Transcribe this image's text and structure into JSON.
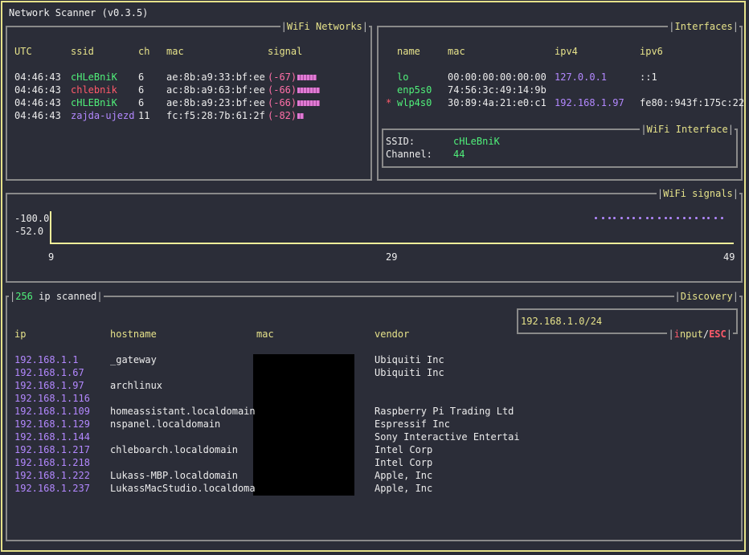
{
  "app": {
    "title": "Network Scanner (v0.3.5)"
  },
  "wifi_networks": {
    "title": "WiFi Networks",
    "columns": [
      "UTC",
      "ssid",
      "ch",
      "mac",
      "signal"
    ],
    "rows": [
      {
        "utc": "04:46:43",
        "ssid": "cHLeBniK",
        "ch": "6",
        "mac": "ae:8b:a9:33:bf:ee",
        "signal": "(-67)",
        "strength": 0.6,
        "color": "#50f07a"
      },
      {
        "utc": "04:46:43",
        "ssid": "chlebnik",
        "ch": "6",
        "mac": "ac:8b:a9:63:bf:ee",
        "signal": "(-66)",
        "strength": 0.7,
        "color": "#ff5a6a"
      },
      {
        "utc": "04:46:43",
        "ssid": "cHLEBniK",
        "ch": "6",
        "mac": "ae:8b:a9:23:bf:ee",
        "signal": "(-66)",
        "strength": 0.7,
        "color": "#50f07a"
      },
      {
        "utc": "04:46:43",
        "ssid": "zajda-ujezd",
        "ch": "11",
        "mac": "fc:f5:28:7b:61:2f",
        "signal": "(-82)",
        "strength": 0.2,
        "color": "#b388ff"
      }
    ]
  },
  "interfaces": {
    "title": "Interfaces",
    "columns": [
      "name",
      "mac",
      "ipv4",
      "ipv6"
    ],
    "rows": [
      {
        "marker": "",
        "name": "lo",
        "mac": "00:00:00:00:00:00",
        "ipv4": "127.0.0.1",
        "ipv6": "::1"
      },
      {
        "marker": "",
        "name": "enp5s0",
        "mac": "74:56:3c:49:14:9b",
        "ipv4": "",
        "ipv6": ""
      },
      {
        "marker": "*",
        "name": "wlp4s0",
        "mac": "30:89:4a:21:e0:c1",
        "ipv4": "192.168.1.97",
        "ipv6": "fe80::943f:175c:22"
      }
    ]
  },
  "wifi_interface": {
    "title": "WiFi Interface",
    "ssid_label": "SSID:",
    "ssid_value": "cHLeBniK",
    "channel_label": "Channel:",
    "channel_value": "44"
  },
  "wifi_signals": {
    "title": "WiFi signals",
    "y_top": "-100.0",
    "y_bottom": "-52.0",
    "x_start": "9",
    "x_mid": "29",
    "x_end": "49"
  },
  "chart_data": {
    "type": "scatter",
    "title": "WiFi signals",
    "xlim": [
      9,
      49
    ],
    "ylim": [
      -100.0,
      -52.0
    ],
    "x_ticks": [
      "9",
      "29",
      "49"
    ],
    "y_ticks": [
      "-100.0",
      "-52.0"
    ],
    "series": [
      {
        "values": [
          [
            40.9,
            -100
          ],
          [
            41.3,
            -100
          ],
          [
            41.7,
            -100
          ],
          [
            42.0,
            -100
          ],
          [
            42.4,
            -100
          ],
          [
            42.8,
            -100
          ],
          [
            43.1,
            -100
          ],
          [
            43.5,
            -100
          ],
          [
            43.9,
            -100
          ],
          [
            44.2,
            -100
          ],
          [
            44.6,
            -100
          ],
          [
            45.0,
            -100
          ],
          [
            45.3,
            -100
          ],
          [
            45.7,
            -100
          ],
          [
            46.1,
            -100
          ],
          [
            46.4,
            -100
          ],
          [
            46.8,
            -100
          ],
          [
            47.2,
            -100
          ],
          [
            47.5,
            -100
          ],
          [
            47.9,
            -100
          ],
          [
            48.3,
            -100
          ]
        ]
      }
    ]
  },
  "discovery": {
    "title": "Discovery",
    "scanned_count": "256",
    "scanned_label": " ip scanned",
    "input_value": "192.168.1.0/24",
    "hint_first": "i",
    "hint_rest": "nput",
    "hint_sep": "/",
    "hint_esc": "ESC",
    "columns": [
      "ip",
      "hostname",
      "mac",
      "vendor"
    ],
    "rows": [
      {
        "ip": "192.168.1.1",
        "hostname": "_gateway",
        "vendor": "Ubiquiti Inc"
      },
      {
        "ip": "192.168.1.67",
        "hostname": "",
        "vendor": "Ubiquiti Inc"
      },
      {
        "ip": "192.168.1.97",
        "hostname": "archlinux",
        "vendor": ""
      },
      {
        "ip": "192.168.1.116",
        "hostname": "",
        "vendor": ""
      },
      {
        "ip": "192.168.1.109",
        "hostname": "homeassistant.localdomain",
        "vendor": "Raspberry Pi Trading Ltd"
      },
      {
        "ip": "192.168.1.129",
        "hostname": "nspanel.localdomain",
        "vendor": "Espressif Inc"
      },
      {
        "ip": "192.168.1.144",
        "hostname": "",
        "vendor": "Sony Interactive Entertai"
      },
      {
        "ip": "192.168.1.217",
        "hostname": "chleboarch.localdomain",
        "vendor": "Intel Corp"
      },
      {
        "ip": "192.168.1.218",
        "hostname": "",
        "vendor": "Intel Corp"
      },
      {
        "ip": "192.168.1.222",
        "hostname": "Lukass-MBP.localdomain",
        "vendor": "Apple, Inc"
      },
      {
        "ip": "192.168.1.237",
        "hostname": "LukassMacStudio.localdoma",
        "vendor": "Apple, Inc"
      }
    ]
  }
}
